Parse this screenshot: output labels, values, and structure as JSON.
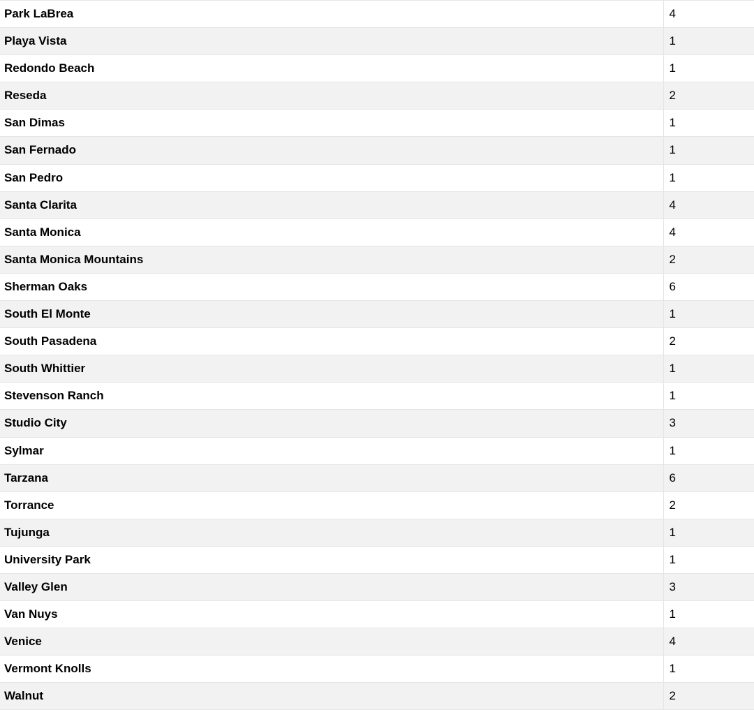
{
  "rows": [
    {
      "name": "Park LaBrea",
      "count": 4
    },
    {
      "name": "Playa Vista",
      "count": 1
    },
    {
      "name": "Redondo Beach",
      "count": 1
    },
    {
      "name": "Reseda",
      "count": 2
    },
    {
      "name": "San Dimas",
      "count": 1
    },
    {
      "name": "San Fernado",
      "count": 1
    },
    {
      "name": "San Pedro",
      "count": 1
    },
    {
      "name": "Santa Clarita",
      "count": 4
    },
    {
      "name": "Santa Monica",
      "count": 4
    },
    {
      "name": "Santa Monica Mountains",
      "count": 2
    },
    {
      "name": "Sherman Oaks",
      "count": 6
    },
    {
      "name": "South El Monte",
      "count": 1
    },
    {
      "name": "South Pasadena",
      "count": 2
    },
    {
      "name": "South Whittier",
      "count": 1
    },
    {
      "name": "Stevenson Ranch",
      "count": 1
    },
    {
      "name": "Studio City",
      "count": 3
    },
    {
      "name": "Sylmar",
      "count": 1
    },
    {
      "name": "Tarzana",
      "count": 6
    },
    {
      "name": "Torrance",
      "count": 2
    },
    {
      "name": "Tujunga",
      "count": 1
    },
    {
      "name": "University Park",
      "count": 1
    },
    {
      "name": "Valley Glen",
      "count": 3
    },
    {
      "name": "Van Nuys",
      "count": 1
    },
    {
      "name": "Venice",
      "count": 4
    },
    {
      "name": "Vermont Knolls",
      "count": 1
    },
    {
      "name": "Walnut",
      "count": 2
    }
  ]
}
